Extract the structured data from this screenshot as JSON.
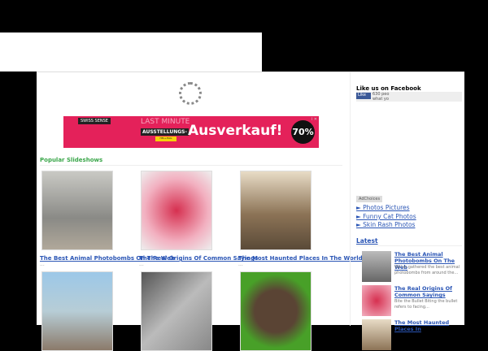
{
  "ad": {
    "brand": "SWISS SENSE",
    "line1": "LAST MINUTE",
    "line2": "AUSSTELLUNGS-",
    "line3": "HEL+HAG",
    "headline": "Ausverkauf!",
    "badge": "70%",
    "adchoice": "i ✕"
  },
  "popular": {
    "title": "Popular Slideshows",
    "items": [
      {
        "title": "The Best Animal Photobombs On The Web",
        "more": "..."
      },
      {
        "title": "The Real Origins Of Common Sayings",
        "more": "..."
      },
      {
        "title": "The Most Haunted Places In The World",
        "more": "..."
      },
      {
        "title": "",
        "more": ""
      },
      {
        "title": "",
        "more": ""
      },
      {
        "title": "",
        "more": ""
      }
    ]
  },
  "sidebar": {
    "fb_title": "Like us on Facebook",
    "fb_like": "Like",
    "fb_count": "630 peo",
    "fb_what": "what yo",
    "adchoices": "AdChoices",
    "links": [
      "► Photos Pictures",
      "► Funny Cat Photos",
      "► Skin Rash Photos"
    ],
    "latest_title": "Latest",
    "latest": [
      {
        "title": "The Best Animal Photobombs On The Web",
        "desc": "We've gathered the best animal photobombs from around the..."
      },
      {
        "title": "The Real Origins Of Common Sayings",
        "desc": "Bite the Bullet Biting the bullet refers to facing..."
      },
      {
        "title": "The Most Haunted Places In",
        "desc": ""
      }
    ]
  }
}
